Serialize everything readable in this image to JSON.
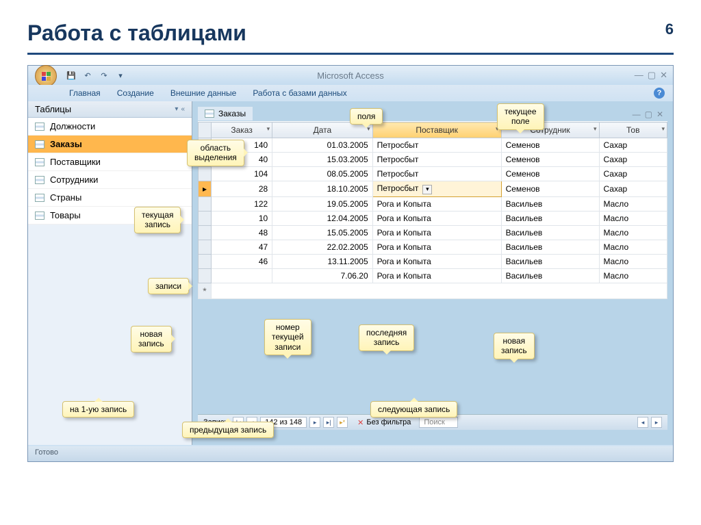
{
  "slide": {
    "title": "Работа с таблицами",
    "number": "6"
  },
  "app_title": "Microsoft Access",
  "ribbon": [
    "Главная",
    "Создание",
    "Внешние данные",
    "Работа с базами данных"
  ],
  "navpane": {
    "header": "Таблицы",
    "items": [
      "Должности",
      "Заказы",
      "Поставщики",
      "Сотрудники",
      "Страны",
      "Товары"
    ],
    "selected_index": 1
  },
  "tab": "Заказы",
  "columns": [
    "Заказ",
    "Дата",
    "Поставщик",
    "Сотрудник",
    "Тов"
  ],
  "active_col_index": 2,
  "active_row_index": 3,
  "rows": [
    {
      "order": "140",
      "date": "01.03.2005",
      "supplier": "Петросбыт",
      "employee": "Семенов",
      "product": "Сахар"
    },
    {
      "order": "40",
      "date": "15.03.2005",
      "supplier": "Петросбыт",
      "employee": "Семенов",
      "product": "Сахар"
    },
    {
      "order": "104",
      "date": "08.05.2005",
      "supplier": "Петросбыт",
      "employee": "Семенов",
      "product": "Сахар"
    },
    {
      "order": "28",
      "date": "18.10.2005",
      "supplier": "Петросбыт",
      "employee": "Семенов",
      "product": "Сахар"
    },
    {
      "order": "122",
      "date": "19.05.2005",
      "supplier": "Рога и Копыта",
      "employee": "Васильев",
      "product": "Масло"
    },
    {
      "order": "10",
      "date": "12.04.2005",
      "supplier": "Рога и Копыта",
      "employee": "Васильев",
      "product": "Масло"
    },
    {
      "order": "48",
      "date": "15.05.2005",
      "supplier": "Рога и Копыта",
      "employee": "Васильев",
      "product": "Масло"
    },
    {
      "order": "47",
      "date": "22.02.2005",
      "supplier": "Рога и Копыта",
      "employee": "Васильев",
      "product": "Масло"
    },
    {
      "order": "46",
      "date": "13.11.2005",
      "supplier": "Рога и Копыта",
      "employee": "Васильев",
      "product": "Масло"
    },
    {
      "order": "",
      "date": "7.06.20",
      "supplier": "Рога и Копыта",
      "employee": "Васильев",
      "product": "Масло"
    }
  ],
  "nav": {
    "label": "Запись:",
    "counter": "142 из 148",
    "filter": "Без фильтра",
    "search": "Поиск"
  },
  "status": "Готово",
  "callouts": {
    "fields": "поля",
    "current_field": "текущее\nполе",
    "selection_area": "область\nвыделения",
    "current_record": "текущая\nзапись",
    "records": "записи",
    "new_record_left": "новая\nзапись",
    "record_number": "номер\nтекущей\nзаписи",
    "last_record": "последняя\nзапись",
    "new_record_right": "новая\nзапись",
    "first_record": "на 1-ую запись",
    "prev_record": "предыдущая запись",
    "next_record": "следующая запись"
  }
}
